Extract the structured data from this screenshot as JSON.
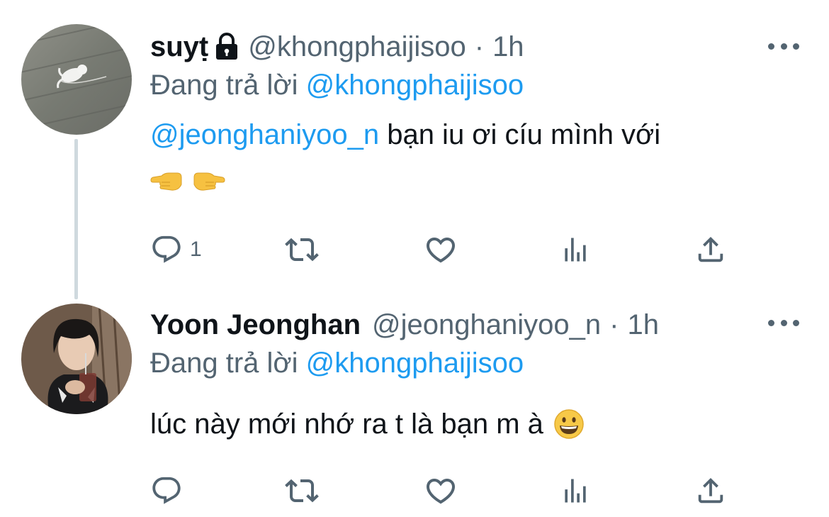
{
  "thread": {
    "tweets": [
      {
        "display_name": "suyṭ",
        "handle": "@khongphaijisoo",
        "separator": "·",
        "time": "1h",
        "reply_prefix": "Đang trả lời",
        "reply_to": "@khongphaijisoo",
        "text_mention": "@jeonghaniyoo_n",
        "text": " bạn iu ơi cíu mình với",
        "emojis": [
          "backhand-index-pointing-left",
          "backhand-index-pointing-right"
        ],
        "reply_count": "1",
        "locked": true
      },
      {
        "display_name": "Yoon Jeonghan",
        "handle": "@jeonghaniyoo_n",
        "separator": "·",
        "time": "1h",
        "reply_prefix": "Đang trả lời",
        "reply_to": "@khongphaijisoo",
        "text": "lúc này mới nhớ ra t là bạn m à",
        "emojis": [
          "grinning-face"
        ],
        "reply_count": ""
      }
    ]
  },
  "colors": {
    "link": "#1d9bf0",
    "secondary_text": "#536471",
    "thread_line": "#cfd9de"
  }
}
